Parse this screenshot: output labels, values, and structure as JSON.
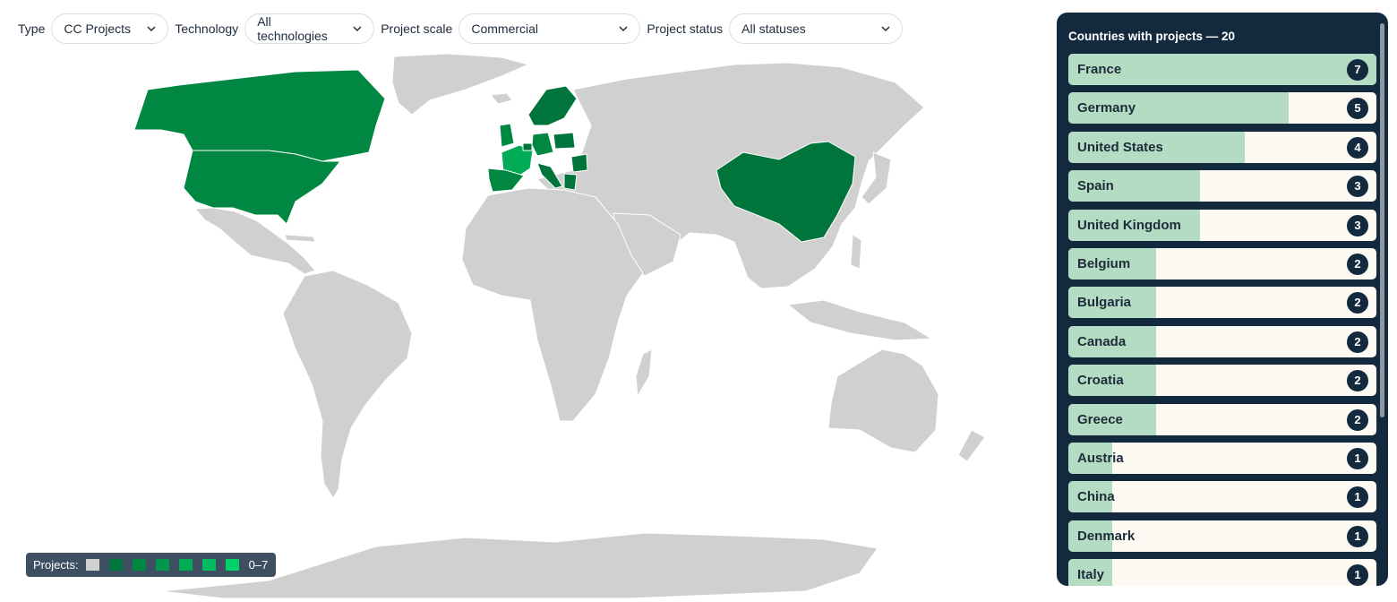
{
  "filters": [
    {
      "label": "Type",
      "value": "CC Projects"
    },
    {
      "label": "Technology",
      "value": "All technologies"
    },
    {
      "label": "Project scale",
      "value": "Commercial"
    },
    {
      "label": "Project status",
      "value": "All statuses"
    }
  ],
  "legend": {
    "label": "Projects:",
    "range": "0–7"
  },
  "colors": {
    "land": "#d0d0d0",
    "scale": [
      "#d0d0d0",
      "#00753b",
      "#008742",
      "#00994b",
      "#00ac55",
      "#00be5f",
      "#00d168"
    ],
    "panel_bg": "#13293d",
    "bar_fill": "#b4dcc2",
    "bar_bg": "#fdf9f3"
  },
  "panel": {
    "title": "Countries with projects — 20",
    "max": 7,
    "countries": [
      {
        "name": "France",
        "count": "7",
        "value": 7
      },
      {
        "name": "Germany",
        "count": "5",
        "value": 5
      },
      {
        "name": "United States",
        "count": "4",
        "value": 4
      },
      {
        "name": "Spain",
        "count": "3",
        "value": 3
      },
      {
        "name": "United Kingdom",
        "count": "3",
        "value": 3
      },
      {
        "name": "Belgium",
        "count": "2",
        "value": 2
      },
      {
        "name": "Bulgaria",
        "count": "2",
        "value": 2
      },
      {
        "name": "Canada",
        "count": "2",
        "value": 2
      },
      {
        "name": "Croatia",
        "count": "2",
        "value": 2
      },
      {
        "name": "Greece",
        "count": "2",
        "value": 2
      },
      {
        "name": "Austria",
        "count": "1",
        "value": 1
      },
      {
        "name": "China",
        "count": "1",
        "value": 1
      },
      {
        "name": "Denmark",
        "count": "1",
        "value": 1
      },
      {
        "name": "Italy",
        "count": "1",
        "value": 1
      }
    ]
  }
}
